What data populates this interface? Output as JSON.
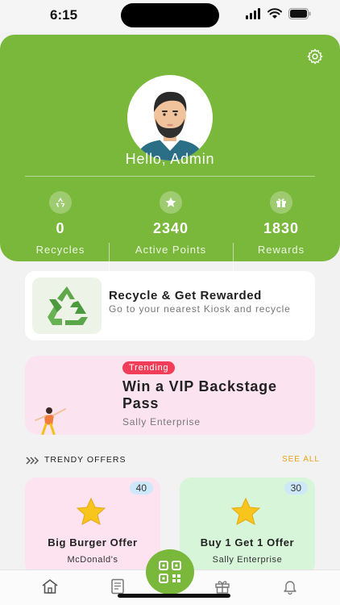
{
  "status_bar": {
    "time": "6:15"
  },
  "profile": {
    "greeting": "Hello, Admin",
    "settings_icon": "gear-icon",
    "avatar": "user-avatar"
  },
  "stats": [
    {
      "icon": "recycle-icon",
      "value": "0",
      "label": "Recycles"
    },
    {
      "icon": "star-icon",
      "value": "2340",
      "label": "Active Points"
    },
    {
      "icon": "gift-icon",
      "value": "1830",
      "label": "Rewards"
    }
  ],
  "recycle_card": {
    "title": "Recycle & Get Rewarded",
    "subtitle": "Go to your nearest Kiosk and recycle"
  },
  "promo_card": {
    "badge": "Trending",
    "title": "Win a VIP Backstage Pass",
    "sponsor": "Sally Enterprise"
  },
  "section": {
    "title": "TRENDY OFFERS",
    "see_all": "SEE ALL"
  },
  "offers": [
    {
      "badge": "40",
      "title": "Big Burger Offer",
      "sub": "McDonald's",
      "bg": "#fce3ef"
    },
    {
      "badge": "30",
      "title": "Buy 1 Get 1 Offer",
      "sub": "Sally Enterprise",
      "bg": "#d7f5d9"
    }
  ],
  "nav": [
    "home-icon",
    "receipt-icon",
    "qr-code-icon",
    "gift-icon",
    "bell-icon"
  ],
  "colors": {
    "brand_green": "#79b83a",
    "trending_red": "#f23d58",
    "see_all_orange": "#e9a21d"
  }
}
